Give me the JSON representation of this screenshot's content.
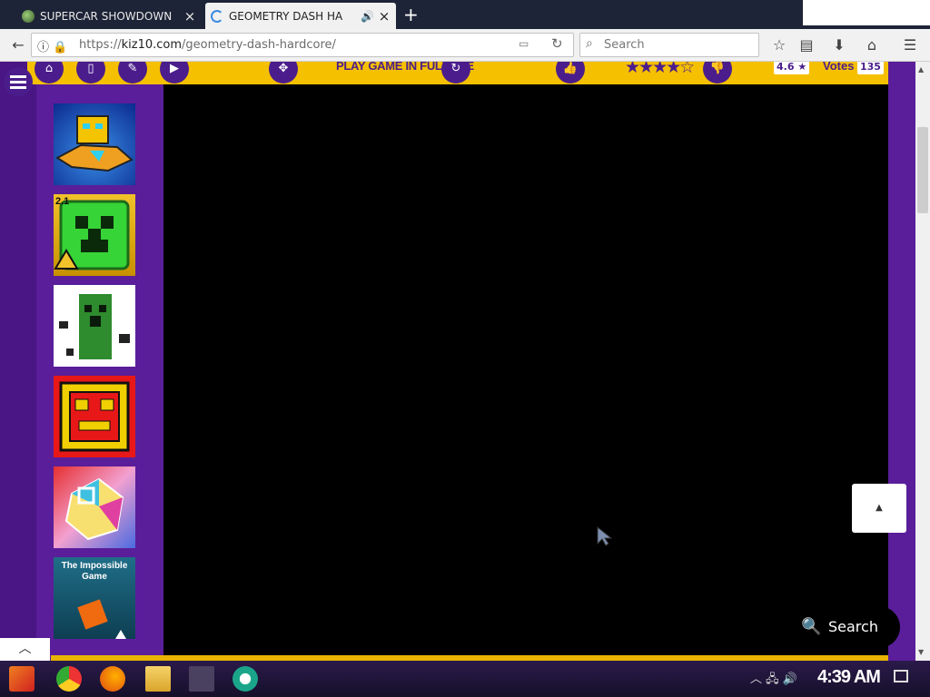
{
  "tabs": [
    {
      "title": "SUPERCAR SHOWDOWN",
      "close": "×"
    },
    {
      "title": "GEOMETRY DASH HA",
      "close": "×"
    }
  ],
  "new_tab": "+",
  "url": {
    "prefix": "https://",
    "domain": "kiz10.com",
    "path": "/geometry-dash-hardcore/"
  },
  "search": {
    "placeholder": "Search"
  },
  "game_bar": {
    "fullsize_label": "PLAY GAME IN FULLSIZE",
    "rating": "4.6",
    "votes_label": "Votes",
    "votes_count": "135"
  },
  "sidebar_games": [
    {
      "label": ""
    },
    {
      "label": "2.1"
    },
    {
      "label": ""
    },
    {
      "label": ""
    },
    {
      "label": ""
    },
    {
      "label": "The Impossible Game"
    }
  ],
  "floating_search": "Search",
  "clock": "4:39 AM"
}
